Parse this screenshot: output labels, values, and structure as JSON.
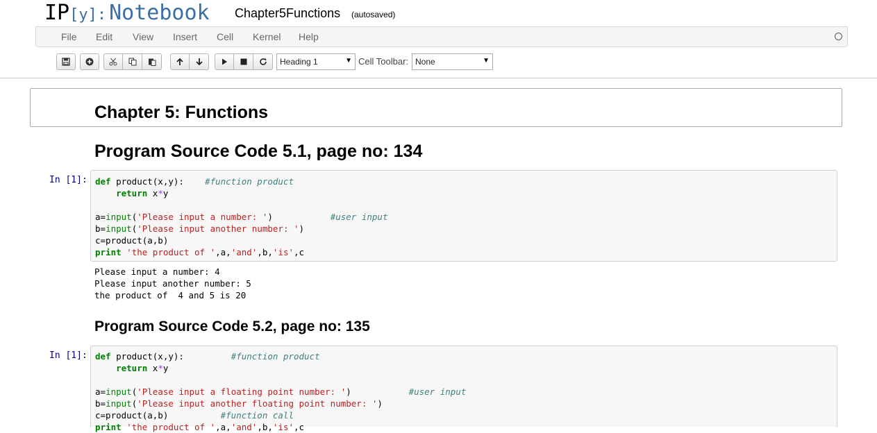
{
  "header": {
    "logo_ip": "IP",
    "logo_y": "[y]:",
    "logo_notebook": "Notebook",
    "notebook_name": "Chapter5Functions",
    "autosave_status": "(autosaved)"
  },
  "menu": [
    "File",
    "Edit",
    "View",
    "Insert",
    "Cell",
    "Kernel",
    "Help"
  ],
  "toolbar": {
    "cell_type_value": "Heading 1",
    "cell_toolbar_label": "Cell Toolbar:",
    "cell_toolbar_value": "None",
    "buttons": [
      "save-icon",
      "add-cell-icon",
      "cut-icon",
      "copy-icon",
      "paste-icon",
      "move-up-icon",
      "move-down-icon",
      "run-icon",
      "stop-icon",
      "restart-icon"
    ]
  },
  "cells": {
    "heading_chapter": "Chapter 5: Functions",
    "heading_program_1": "Program Source Code 5.1, page no: 134",
    "prompt_1": "In [1]:",
    "output_1": [
      "Please input a number: 4",
      "Please input another number: 5",
      "the product of  4 and 5 is 20"
    ],
    "heading_program_2": "Program Source Code 5.2, page no: 135",
    "prompt_2": "In [1]:"
  },
  "code_1": {
    "l1_kw": "def",
    "l1_sig": " product(x,y):    ",
    "l1_cm": "#function product",
    "l2_kw": "return",
    "l2_a": " x",
    "l2_op": "*",
    "l2_b": "y",
    "l4_a": "a=",
    "l4_fn": "input",
    "l4_p1": "(",
    "l4_str": "'Please input a number: '",
    "l4_p2": ")           ",
    "l4_cm": "#user input",
    "l5_a": "b=",
    "l5_fn": "input",
    "l5_p1": "(",
    "l5_str": "'Please input another number: '",
    "l5_p2": ")",
    "l6": "c=product(a,b)",
    "l7_kw": "print",
    "l7_s1": "'the product of '",
    "l7_c1": ",a,",
    "l7_s2": "'and'",
    "l7_c2": ",b,",
    "l7_s3": "'is'",
    "l7_c3": ",c"
  },
  "code_2": {
    "l1_kw": "def",
    "l1_sig": " product(x,y):         ",
    "l1_cm": "#function product",
    "l2_kw": "return",
    "l2_a": " x",
    "l2_op": "*",
    "l2_b": "y",
    "l4_a": "a=",
    "l4_fn": "input",
    "l4_p1": "(",
    "l4_str": "'Please input a floating point number: '",
    "l4_p2": ")           ",
    "l4_cm": "#user input",
    "l5_a": "b=",
    "l5_fn": "input",
    "l5_p1": "(",
    "l5_str": "'Please input another floating point number: '",
    "l5_p2": ")",
    "l6": "c=product(a,b)          ",
    "l6_cm": "#function call",
    "l7_kw": "print",
    "l7_s1": "'the product of '",
    "l7_c1": ",a,",
    "l7_s2": "'and'",
    "l7_c2": ",b,",
    "l7_s3": "'is'",
    "l7_c3": ",c"
  }
}
